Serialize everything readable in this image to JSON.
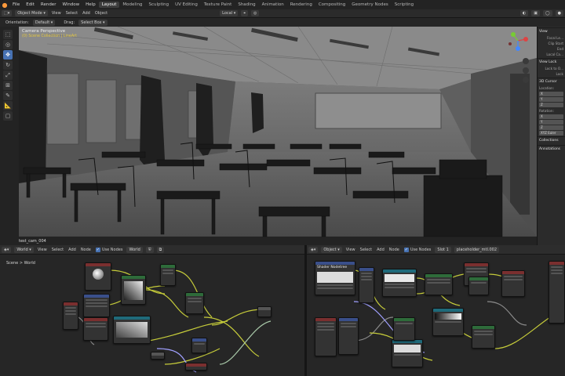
{
  "menubar": {
    "items": [
      "File",
      "Edit",
      "Render",
      "Window",
      "Help"
    ],
    "workspaces": [
      "Layout",
      "Modeling",
      "Sculpting",
      "UV Editing",
      "Texture Paint",
      "Shading",
      "Animation",
      "Rendering",
      "Compositing",
      "Geometry Nodes",
      "Scripting"
    ],
    "active_workspace": "Layout"
  },
  "viewport_header": {
    "mode": "Object Mode",
    "menus": [
      "View",
      "Select",
      "Add",
      "Object"
    ],
    "transform_space": "Local"
  },
  "tool_settings": {
    "orientation_label": "Orientation:",
    "orientation_value": "Default",
    "drag_label": "Drag:",
    "drag_value": "Select Box"
  },
  "viewport": {
    "view_name": "Camera Perspective",
    "collection_info": "(0) Scene Collection | LineArt",
    "camera_name": "test_cam_004"
  },
  "n_panel": {
    "view_header": "View",
    "focal_label": "Focal Le...",
    "clip_start": "Clip Start",
    "clip_end": "End",
    "local_camera": "Local Ca...",
    "view_lock": "View Lock",
    "lock_to_obj": "Lock to O...",
    "lock": "Lock",
    "cursor_header": "3D Cursor",
    "location": "Location:",
    "axes": [
      "X",
      "Y",
      "Z"
    ],
    "rotation": "Rotation:",
    "rot_mode": "XYZ Euler",
    "collections": "Collections",
    "annotations": "Annotations"
  },
  "world_editor": {
    "type_label": "World",
    "menus": [
      "View",
      "Select",
      "Add",
      "Node"
    ],
    "use_nodes": "Use Nodes",
    "datablock": "World",
    "breadcrumb": [
      "Scene",
      "World"
    ]
  },
  "shader_editor": {
    "type_label": "Object",
    "menus": [
      "View",
      "Select",
      "Add",
      "Node"
    ],
    "use_nodes": "Use Nodes",
    "slot": "Slot 1",
    "material": "placeholder_mtl.002",
    "node_title": "Shader Nodetree"
  },
  "colors": {
    "accent": "#4772b3",
    "header": "#2b2b2b",
    "node_green": "#2e6b3a",
    "node_teal": "#1f6a7a",
    "node_red": "#7a2f2f",
    "node_blue": "#3a4f8a",
    "wire_yellow": "#c6cc3a",
    "wire_gray": "#8a8a8a"
  },
  "icons": [
    "editor-type-icon",
    "move-icon",
    "rotate-icon",
    "scale-icon",
    "annotate-icon",
    "measure-icon",
    "cursor-icon",
    "camera-icon",
    "hand-icon",
    "zoom-icon",
    "grid-icon"
  ]
}
